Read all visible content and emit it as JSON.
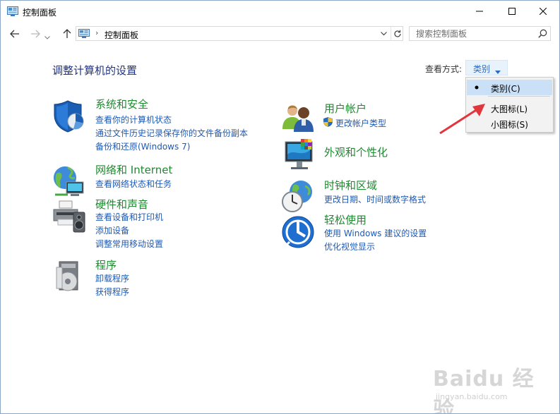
{
  "window": {
    "title": "控制面板",
    "icon": "control-panel-icon"
  },
  "nav": {
    "address_path": "控制面板",
    "search_placeholder": "搜索控制面板"
  },
  "main": {
    "page_title": "调整计算机的设置",
    "view_by_label": "查看方式:",
    "view_by_value": "类别"
  },
  "categories": [
    {
      "title": "系统和安全",
      "icon": "shield-icon",
      "links": [
        "查看你的计算机状态",
        "通过文件历史记录保存你的文件备份副本",
        "备份和还原(Windows 7)"
      ]
    },
    {
      "title": "网络和 Internet",
      "icon": "network-globe-icon",
      "links": [
        "查看网络状态和任务"
      ]
    },
    {
      "title": "硬件和声音",
      "icon": "printer-speaker-icon",
      "links": [
        "查看设备和打印机",
        "添加设备",
        "调整常用移动设置"
      ]
    },
    {
      "title": "程序",
      "icon": "programs-disc-icon",
      "links": [
        "卸载程序",
        "获得程序"
      ]
    },
    {
      "title": "用户帐户",
      "icon": "users-icon",
      "links": [
        "更改帐户类型"
      ]
    },
    {
      "title": "外观和个性化",
      "icon": "monitor-palette-icon",
      "links": []
    },
    {
      "title": "时钟和区域",
      "icon": "clock-globe-icon",
      "links": [
        "更改日期、时间或数字格式"
      ]
    },
    {
      "title": "轻松使用",
      "icon": "ease-of-access-icon",
      "links": [
        "使用 Windows 建议的设置",
        "优化视觉显示"
      ]
    }
  ],
  "view_menu": {
    "items": [
      {
        "label": "类别(C)",
        "selected": true
      },
      {
        "label": "大图标(L)",
        "selected": false
      },
      {
        "label": "小图标(S)",
        "selected": false
      }
    ]
  },
  "watermark": {
    "text": "Baidu 经验",
    "url": "jingyan.baidu.com"
  },
  "colors": {
    "category_title": "#1d8a2f",
    "link": "#1e5ab5",
    "page_title": "#1e3287",
    "annotation_arrow": "#e0363c",
    "menu_selected": "#c9e0f7"
  }
}
